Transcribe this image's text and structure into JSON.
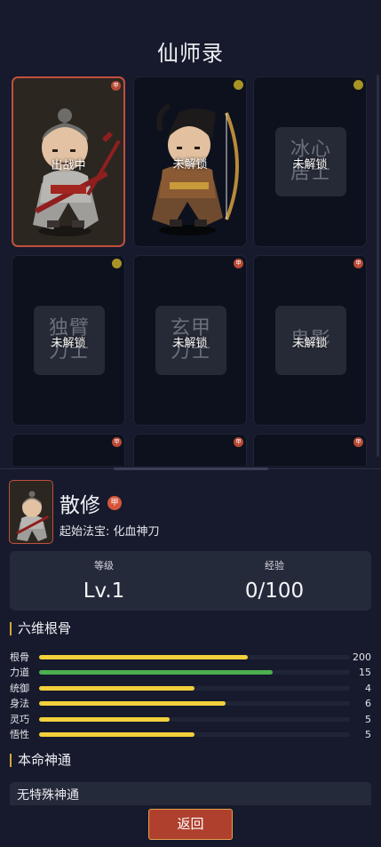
{
  "page": {
    "title": "仙师录"
  },
  "cards": [
    {
      "status": "出战中",
      "badge": "甲",
      "badge_color": "red",
      "selected": true,
      "plate": ""
    },
    {
      "status": "未解锁",
      "badge": "",
      "badge_color": "gold",
      "selected": false,
      "plate": ""
    },
    {
      "status": "未解锁",
      "badge": "",
      "badge_color": "gold",
      "selected": false,
      "plate": "冰心居士"
    },
    {
      "status": "未解锁",
      "badge": "",
      "badge_color": "gold",
      "selected": false,
      "plate": "独臂力士"
    },
    {
      "status": "未解锁",
      "badge": "甲",
      "badge_color": "red",
      "selected": false,
      "plate": "玄甲力士"
    },
    {
      "status": "未解锁",
      "badge": "甲",
      "badge_color": "red",
      "selected": false,
      "plate": "鬼影"
    },
    {
      "status": "",
      "badge": "甲",
      "badge_color": "red",
      "selected": false,
      "plate": ""
    },
    {
      "status": "",
      "badge": "甲",
      "badge_color": "red",
      "selected": false,
      "plate": ""
    },
    {
      "status": "",
      "badge": "甲",
      "badge_color": "red",
      "selected": false,
      "plate": ""
    }
  ],
  "hero": {
    "name": "散修",
    "tag": "甲",
    "sub": "起始法宝: 化血神刀",
    "level_label": "等级",
    "level_value": "Lv.1",
    "exp_label": "经验",
    "exp_value": "0/100"
  },
  "attributes_title": "六维根骨",
  "attributes": [
    {
      "name": "根骨",
      "value": "200",
      "fraction": 0.67,
      "color": "#f2d03c"
    },
    {
      "name": "力道",
      "value": "15",
      "fraction": 0.75,
      "color": "#4caf50"
    },
    {
      "name": "统御",
      "value": "4",
      "fraction": 0.5,
      "color": "#f2d03c"
    },
    {
      "name": "身法",
      "value": "6",
      "fraction": 0.6,
      "color": "#f2d03c"
    },
    {
      "name": "灵巧",
      "value": "5",
      "fraction": 0.42,
      "color": "#f2d03c"
    },
    {
      "name": "悟性",
      "value": "5",
      "fraction": 0.5,
      "color": "#f2d03c"
    }
  ],
  "skill_title": "本命神通",
  "skill_text": "无特殊神通",
  "back_label": "返回",
  "colors": {
    "accent_red": "#b0402e",
    "gold": "#d4a73a",
    "bar_yellow": "#f2d03c",
    "bar_green": "#4caf50"
  }
}
